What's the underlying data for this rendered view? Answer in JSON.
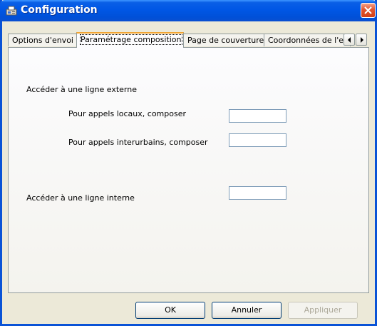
{
  "window": {
    "title": "Configuration",
    "title_icon": "fax-icon",
    "accent": "#0a5fe6"
  },
  "tabs": [
    {
      "label": "Options d'envoi"
    },
    {
      "label": "Paramétrage composition"
    },
    {
      "label": "Page de couverture"
    },
    {
      "label": "Coordonnées de l'expé"
    }
  ],
  "active_tab": "Paramétrage composition",
  "panel": {
    "external_section": "Accéder à une ligne externe",
    "local_label": "Pour appels locaux, composer",
    "local_value": "",
    "longdistance_label": "Pour appels interurbains, composer",
    "longdistance_value": "",
    "internal_label": "Accéder à une ligne interne",
    "internal_value": ""
  },
  "buttons": {
    "ok": "OK",
    "cancel": "Annuler",
    "apply": "Appliquer"
  }
}
